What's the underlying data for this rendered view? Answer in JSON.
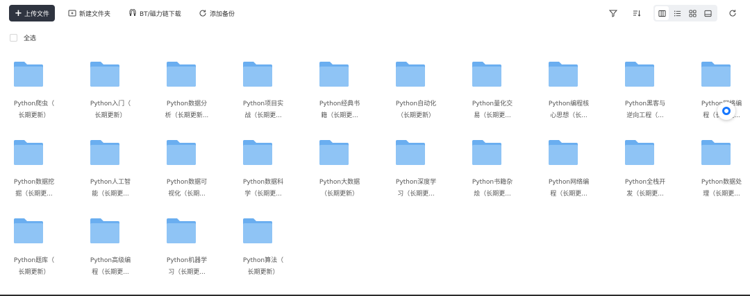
{
  "toolbar": {
    "upload_label": "上传文件",
    "new_folder_label": "新建文件夹",
    "bt_label": "BT/磁力链下载",
    "backup_label": "添加备份"
  },
  "select_all_label": "全选",
  "files": [
    {
      "line1": "Python爬虫（",
      "line2": "长期更新）"
    },
    {
      "line1": "Python入门（",
      "line2": "长期更新）"
    },
    {
      "line1": "Python数据分",
      "line2": "析（长期更新..."
    },
    {
      "line1": "Python项目实",
      "line2": "战（长期更..."
    },
    {
      "line1": "Python经典书",
      "line2": "籍（长期更..."
    },
    {
      "line1": "Python自动化",
      "line2": "（长期更新）"
    },
    {
      "line1": "Python量化交",
      "line2": "易（长期更..."
    },
    {
      "line1": "Python编程核",
      "line2": "心思想（长..."
    },
    {
      "line1": "Python黑客与",
      "line2": "逆向工程（..."
    },
    {
      "line1": "Python网络编",
      "line2": "程（长期更..."
    },
    {
      "line1": "Python数据挖",
      "line2": "掘（长期更..."
    },
    {
      "line1": "Python人工智",
      "line2": "能（长期更..."
    },
    {
      "line1": "Python数据可",
      "line2": "视化（长期..."
    },
    {
      "line1": "Python数据科",
      "line2": "学（长期更..."
    },
    {
      "line1": "Python大数据",
      "line2": "（长期更新）"
    },
    {
      "line1": "Python深度学",
      "line2": "习（长期更..."
    },
    {
      "line1": "Python书籍杂",
      "line2": "烩（长期更..."
    },
    {
      "line1": "Python网络编",
      "line2": "程（长期更..."
    },
    {
      "line1": "Python全栈开",
      "line2": "发（长期更..."
    },
    {
      "line1": "Python数据处",
      "line2": "理（长期更..."
    },
    {
      "line1": "Python题库（",
      "line2": "长期更新）"
    },
    {
      "line1": "Python高级编",
      "line2": "程（长期更..."
    },
    {
      "line1": "Python机器学",
      "line2": "习（长期更..."
    },
    {
      "line1": "Python算法（",
      "line2": "长期更新）"
    }
  ],
  "colors": {
    "primary_button": "#2f3440",
    "folder_front": "#8fc4f5",
    "folder_back": "#6aaef0",
    "accent": "#1677ff"
  },
  "icons": {
    "filter": "filter-icon",
    "sort": "sort-icon",
    "view_columns": "columns-view-icon",
    "view_list": "list-view-icon",
    "view_grid": "grid-view-icon",
    "view_large": "thumbnail-view-icon",
    "refresh": "refresh-icon"
  }
}
